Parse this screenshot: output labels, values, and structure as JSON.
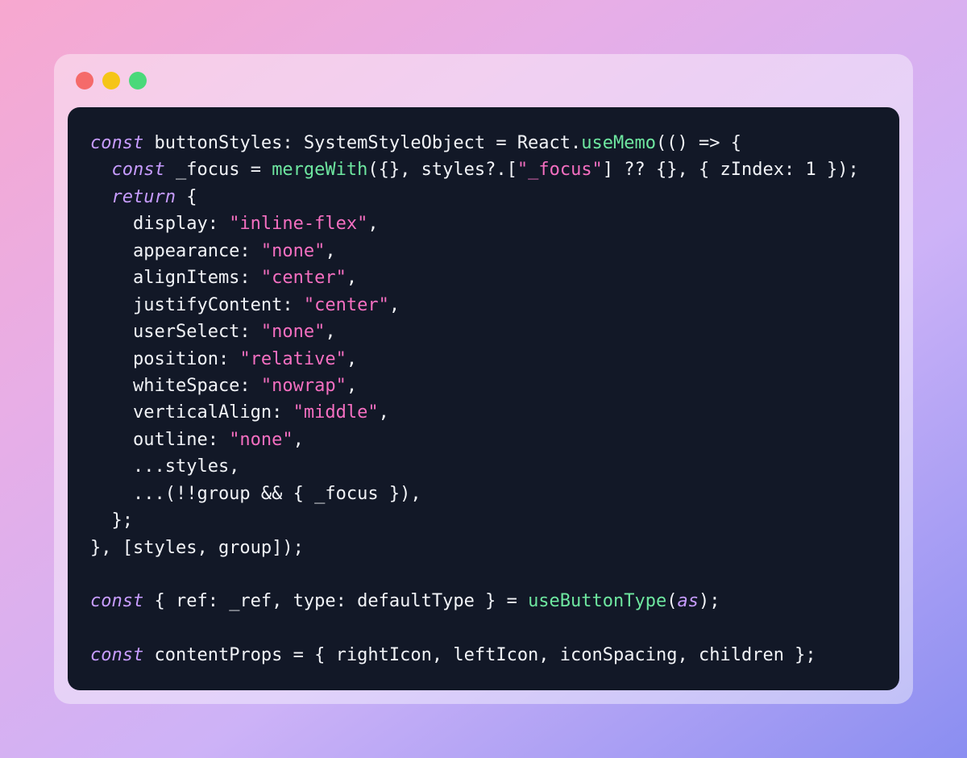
{
  "window": {
    "dots": [
      {
        "name": "close",
        "color": "#f56a6a"
      },
      {
        "name": "minimize",
        "color": "#f5c518"
      },
      {
        "name": "maximize",
        "color": "#4ad97a"
      }
    ]
  },
  "code": {
    "lines": [
      [
        {
          "t": "kw",
          "v": "const"
        },
        {
          "t": "txt",
          "v": " buttonStyles: SystemStyleObject = React."
        },
        {
          "t": "fn",
          "v": "useMemo"
        },
        {
          "t": "txt",
          "v": "(() => {"
        }
      ],
      [
        {
          "t": "txt",
          "v": "  "
        },
        {
          "t": "kw",
          "v": "const"
        },
        {
          "t": "txt",
          "v": " _focus = "
        },
        {
          "t": "fn",
          "v": "mergeWith"
        },
        {
          "t": "txt",
          "v": "({}, styles?.["
        },
        {
          "t": "str",
          "v": "\"_focus\""
        },
        {
          "t": "txt",
          "v": "] ?? {}, { zIndex: 1 });"
        }
      ],
      [
        {
          "t": "txt",
          "v": "  "
        },
        {
          "t": "kw",
          "v": "return"
        },
        {
          "t": "txt",
          "v": " {"
        }
      ],
      [
        {
          "t": "txt",
          "v": "    display: "
        },
        {
          "t": "str",
          "v": "\"inline-flex\""
        },
        {
          "t": "txt",
          "v": ","
        }
      ],
      [
        {
          "t": "txt",
          "v": "    appearance: "
        },
        {
          "t": "str",
          "v": "\"none\""
        },
        {
          "t": "txt",
          "v": ","
        }
      ],
      [
        {
          "t": "txt",
          "v": "    alignItems: "
        },
        {
          "t": "str",
          "v": "\"center\""
        },
        {
          "t": "txt",
          "v": ","
        }
      ],
      [
        {
          "t": "txt",
          "v": "    justifyContent: "
        },
        {
          "t": "str",
          "v": "\"center\""
        },
        {
          "t": "txt",
          "v": ","
        }
      ],
      [
        {
          "t": "txt",
          "v": "    userSelect: "
        },
        {
          "t": "str",
          "v": "\"none\""
        },
        {
          "t": "txt",
          "v": ","
        }
      ],
      [
        {
          "t": "txt",
          "v": "    position: "
        },
        {
          "t": "str",
          "v": "\"relative\""
        },
        {
          "t": "txt",
          "v": ","
        }
      ],
      [
        {
          "t": "txt",
          "v": "    whiteSpace: "
        },
        {
          "t": "str",
          "v": "\"nowrap\""
        },
        {
          "t": "txt",
          "v": ","
        }
      ],
      [
        {
          "t": "txt",
          "v": "    verticalAlign: "
        },
        {
          "t": "str",
          "v": "\"middle\""
        },
        {
          "t": "txt",
          "v": ","
        }
      ],
      [
        {
          "t": "txt",
          "v": "    outline: "
        },
        {
          "t": "str",
          "v": "\"none\""
        },
        {
          "t": "txt",
          "v": ","
        }
      ],
      [
        {
          "t": "txt",
          "v": "    ...styles,"
        }
      ],
      [
        {
          "t": "txt",
          "v": "    ...(!!group && { _focus }),"
        }
      ],
      [
        {
          "t": "txt",
          "v": "  };"
        }
      ],
      [
        {
          "t": "txt",
          "v": "}, [styles, group]);"
        }
      ],
      [],
      [
        {
          "t": "kw",
          "v": "const"
        },
        {
          "t": "txt",
          "v": " { ref: _ref, type: defaultType } = "
        },
        {
          "t": "fn",
          "v": "useButtonType"
        },
        {
          "t": "txt",
          "v": "("
        },
        {
          "t": "kw",
          "v": "as"
        },
        {
          "t": "txt",
          "v": ");"
        }
      ],
      [],
      [
        {
          "t": "kw",
          "v": "const"
        },
        {
          "t": "txt",
          "v": " contentProps = { rightIcon, leftIcon, iconSpacing, children };"
        }
      ]
    ]
  }
}
